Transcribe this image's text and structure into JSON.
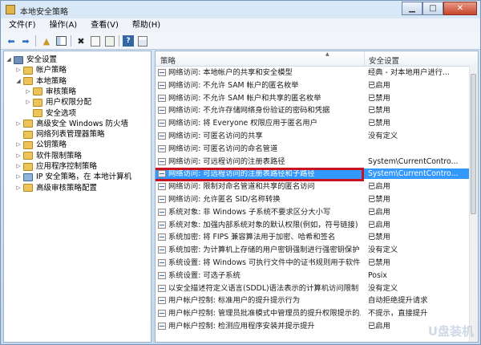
{
  "window": {
    "title": "本地安全策略"
  },
  "menu": [
    "文件(F)",
    "操作(A)",
    "查看(V)",
    "帮助(H)"
  ],
  "tree": [
    {
      "label": "安全设置",
      "level": 0,
      "twisty": "◢",
      "kind": "root"
    },
    {
      "label": "帐户策略",
      "level": 1,
      "twisty": "▷",
      "kind": "folder"
    },
    {
      "label": "本地策略",
      "level": 1,
      "twisty": "◢",
      "kind": "folder"
    },
    {
      "label": "审核策略",
      "level": 2,
      "twisty": "▷",
      "kind": "folder"
    },
    {
      "label": "用户权限分配",
      "level": 2,
      "twisty": "▷",
      "kind": "folder"
    },
    {
      "label": "安全选项",
      "level": 2,
      "twisty": "",
      "kind": "folder"
    },
    {
      "label": "高级安全 Windows 防火墙",
      "level": 1,
      "twisty": "▷",
      "kind": "folder"
    },
    {
      "label": "网络列表管理器策略",
      "level": 1,
      "twisty": "",
      "kind": "folder"
    },
    {
      "label": "公钥策略",
      "level": 1,
      "twisty": "▷",
      "kind": "folder"
    },
    {
      "label": "软件限制策略",
      "level": 1,
      "twisty": "▷",
      "kind": "folder"
    },
    {
      "label": "应用程序控制策略",
      "level": 1,
      "twisty": "▷",
      "kind": "folder"
    },
    {
      "label": "IP 安全策略，在 本地计算机",
      "level": 1,
      "twisty": "▷",
      "kind": "net"
    },
    {
      "label": "高级审核策略配置",
      "level": 1,
      "twisty": "▷",
      "kind": "folder"
    }
  ],
  "columns": {
    "policy": "策略",
    "setting": "安全设置"
  },
  "rows": [
    {
      "name": "网络访问: 本地帐户的共享和安全模型",
      "setting": "经典 - 对本地用户进行..."
    },
    {
      "name": "网络访问: 不允许 SAM 帐户的匿名枚举",
      "setting": "已启用"
    },
    {
      "name": "网络访问: 不允许 SAM 帐户和共享的匿名枚举",
      "setting": "已禁用"
    },
    {
      "name": "网络访问: 不允许存储网络身份验证的密码和凭据",
      "setting": "已禁用"
    },
    {
      "name": "网络访问: 将 Everyone 权限应用于匿名用户",
      "setting": "已禁用"
    },
    {
      "name": "网络访问: 可匿名访问的共享",
      "setting": "没有定义"
    },
    {
      "name": "网络访问: 可匿名访问的命名管道",
      "setting": ""
    },
    {
      "name": "网络访问: 可远程访问的注册表路径",
      "setting": "System\\CurrentContro..."
    },
    {
      "name": "网络访问: 可远程访问的注册表路径和子路径",
      "setting": "System\\CurrentContro...",
      "selected": true
    },
    {
      "name": "网络访问: 限制对命名管道和共享的匿名访问",
      "setting": "已启用"
    },
    {
      "name": "网络访问: 允许匿名 SID/名称转换",
      "setting": "已禁用"
    },
    {
      "name": "系统对象: 非 Windows 子系统不要求区分大小写",
      "setting": "已启用"
    },
    {
      "name": "系统对象: 加强内部系统对象的默认权限(例如，符号链接)",
      "setting": "已启用"
    },
    {
      "name": "系统加密: 将 FIPS 兼容算法用于加密、哈希和签名",
      "setting": "已禁用"
    },
    {
      "name": "系统加密: 为计算机上存储的用户密钥强制进行强密钥保护",
      "setting": "没有定义"
    },
    {
      "name": "系统设置: 将 Windows 可执行文件中的证书规则用于软件...",
      "setting": "已禁用"
    },
    {
      "name": "系统设置: 可选子系统",
      "setting": "Posix"
    },
    {
      "name": "以安全描述符定义语言(SDDL)语法表示的计算机访问限制",
      "setting": "没有定义"
    },
    {
      "name": "用户帐户控制: 标准用户的提升提示行为",
      "setting": "自动拒绝提升请求"
    },
    {
      "name": "用户帐户控制: 管理员批准模式中管理员的提升权限提示的...",
      "setting": "不提示，直接提升"
    },
    {
      "name": "用户帐户控制: 检测应用程序安装并提示提升",
      "setting": "已启用"
    }
  ],
  "watermark": "U盘装机"
}
